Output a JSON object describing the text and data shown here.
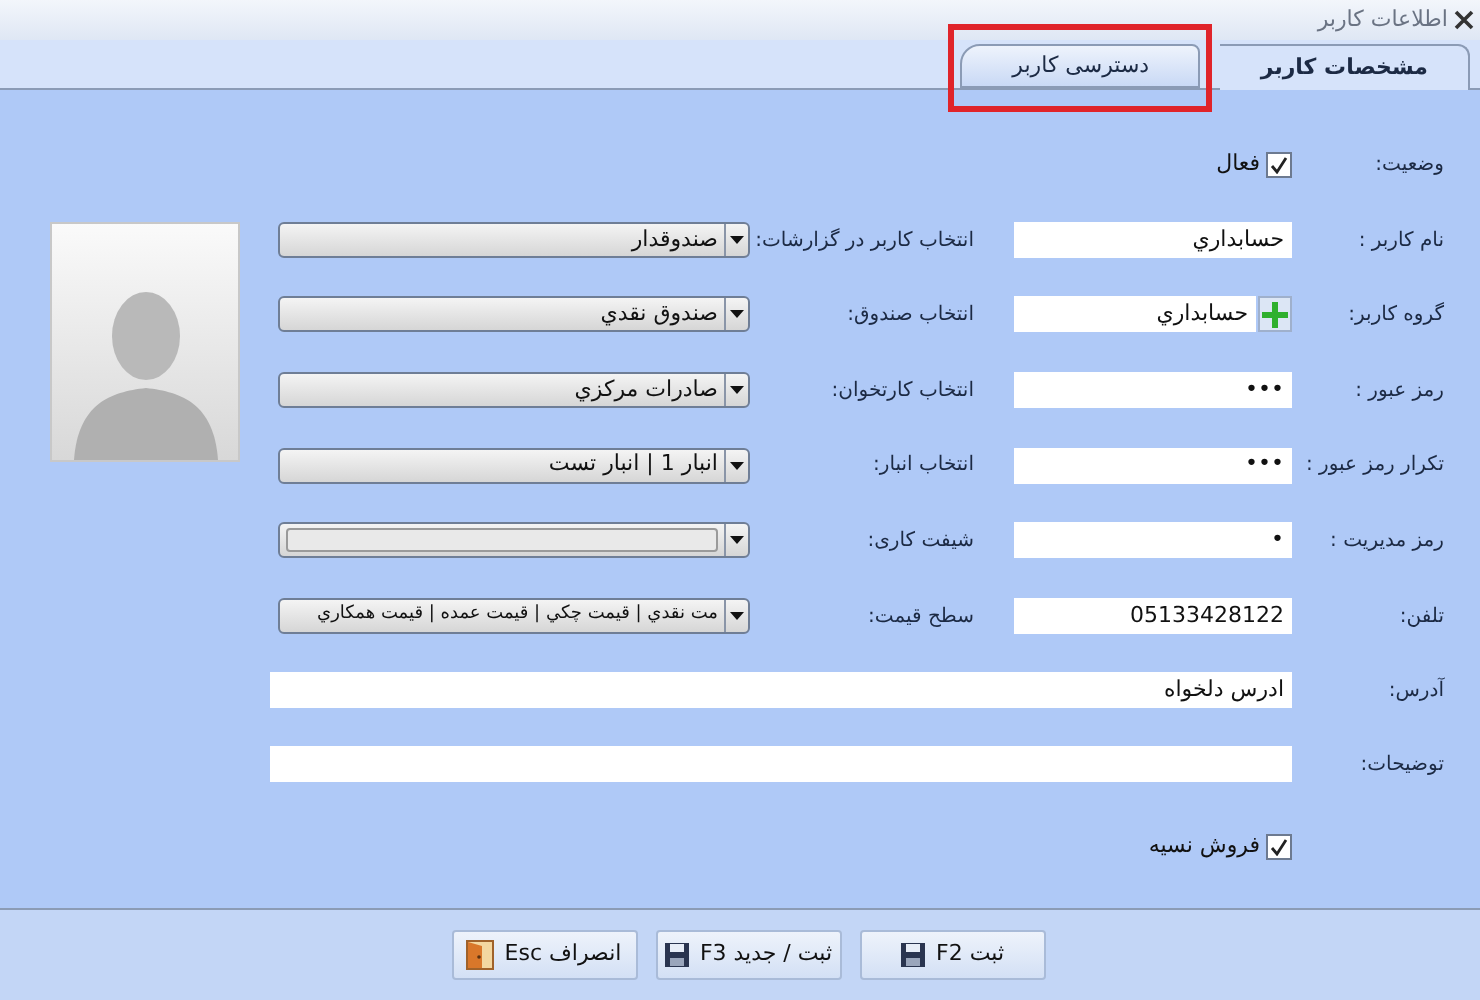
{
  "window": {
    "title": "اطلاعات کاربر"
  },
  "tabs": [
    {
      "label": "مشخصات کاربر",
      "selected": true,
      "highlighted": false
    },
    {
      "label": "دسترسی کاربر",
      "selected": false,
      "highlighted": true
    }
  ],
  "status": {
    "label": "وضعیت:",
    "checkbox": {
      "label": "فعال",
      "checked": true
    }
  },
  "rows": [
    {
      "field": {
        "kind": "text",
        "label": "نام کاربر :",
        "value": "حسابداري"
      },
      "select": {
        "label": "انتخاب کاربر در گزارشات:",
        "value": "صندوقدار"
      }
    },
    {
      "field": {
        "kind": "group",
        "label": "گروه کاربر:",
        "value": "حسابداري"
      },
      "select": {
        "label": "انتخاب صندوق:",
        "value": "صندوق نقدي"
      }
    },
    {
      "field": {
        "kind": "text",
        "label": "رمز عبور :",
        "value": "•••"
      },
      "select": {
        "label": "انتخاب کارتخوان:",
        "value": "صادرات مرکزي"
      }
    },
    {
      "field": {
        "kind": "text",
        "label": "تکرار رمز عبور :",
        "value": "•••"
      },
      "select": {
        "label": "انتخاب انبار:",
        "value": "انبار 1 | انبار تست"
      }
    },
    {
      "field": {
        "kind": "text",
        "label": "رمز مدیریت :",
        "value": "•"
      },
      "select": {
        "label": "شیفت کاری:"
      }
    },
    {
      "field": {
        "kind": "text",
        "label": "تلفن:",
        "value": "05133428122"
      },
      "select": {
        "label": "سطح قیمت:",
        "value": "مت نقدي | قيمت چكي | قيمت عمده | قيمت همكاري"
      }
    }
  ],
  "address": {
    "label": "آدرس:",
    "value": "ادرس دلخواه"
  },
  "notes": {
    "label": "توضیحات:"
  },
  "credit_sale": {
    "label": "فروش نسیه",
    "checked": true
  },
  "buttons": [
    {
      "kind": "save",
      "label": "ثبت F2"
    },
    {
      "kind": "save",
      "label": "ثبت / جدید F3"
    },
    {
      "kind": "cancel",
      "label": "انصراف Esc"
    }
  ]
}
